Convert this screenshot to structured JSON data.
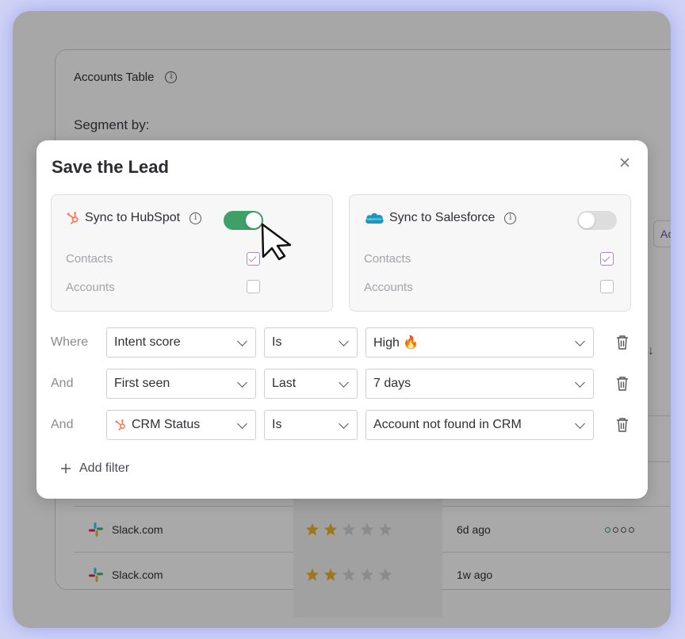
{
  "background": {
    "table_title": "Accounts Table",
    "segment_label": "Segment by:",
    "chip_text": "Ac",
    "rows": [
      {
        "company": "Slack.com",
        "rating": 2,
        "max_rating": 5,
        "when": "6d ago"
      },
      {
        "company": "Slack.com",
        "rating": 2,
        "max_rating": 5,
        "when": "1w ago"
      }
    ]
  },
  "modal": {
    "title": "Save the Lead",
    "hubspot": {
      "label": "Sync to HubSpot",
      "enabled": true,
      "icon": "hubspot-icon",
      "brand_color": "#ff7a59"
    },
    "salesforce": {
      "label": "Sync to Salesforce",
      "enabled": false,
      "icon": "salesforce-cloud-icon",
      "brand_color": "#1798c1",
      "logo_text": "salesforce"
    },
    "options": {
      "contacts": "Contacts",
      "accounts": "Accounts"
    },
    "filters": [
      {
        "conjunction": "Where",
        "field": "Intent score",
        "operator": "Is",
        "value": "High 🔥"
      },
      {
        "conjunction": "And",
        "field": "First seen",
        "operator": "Last",
        "value": "7 days"
      },
      {
        "conjunction": "And",
        "field": "CRM Status",
        "operator": "Is",
        "value": "Account not found in CRM"
      }
    ],
    "add_filter": "Add filter"
  },
  "colors": {
    "toggle_on": "#3e9f69",
    "toggle_off": "#dddddd",
    "check_purple": "#a58ac7",
    "backdrop": "#cfd3f6"
  }
}
